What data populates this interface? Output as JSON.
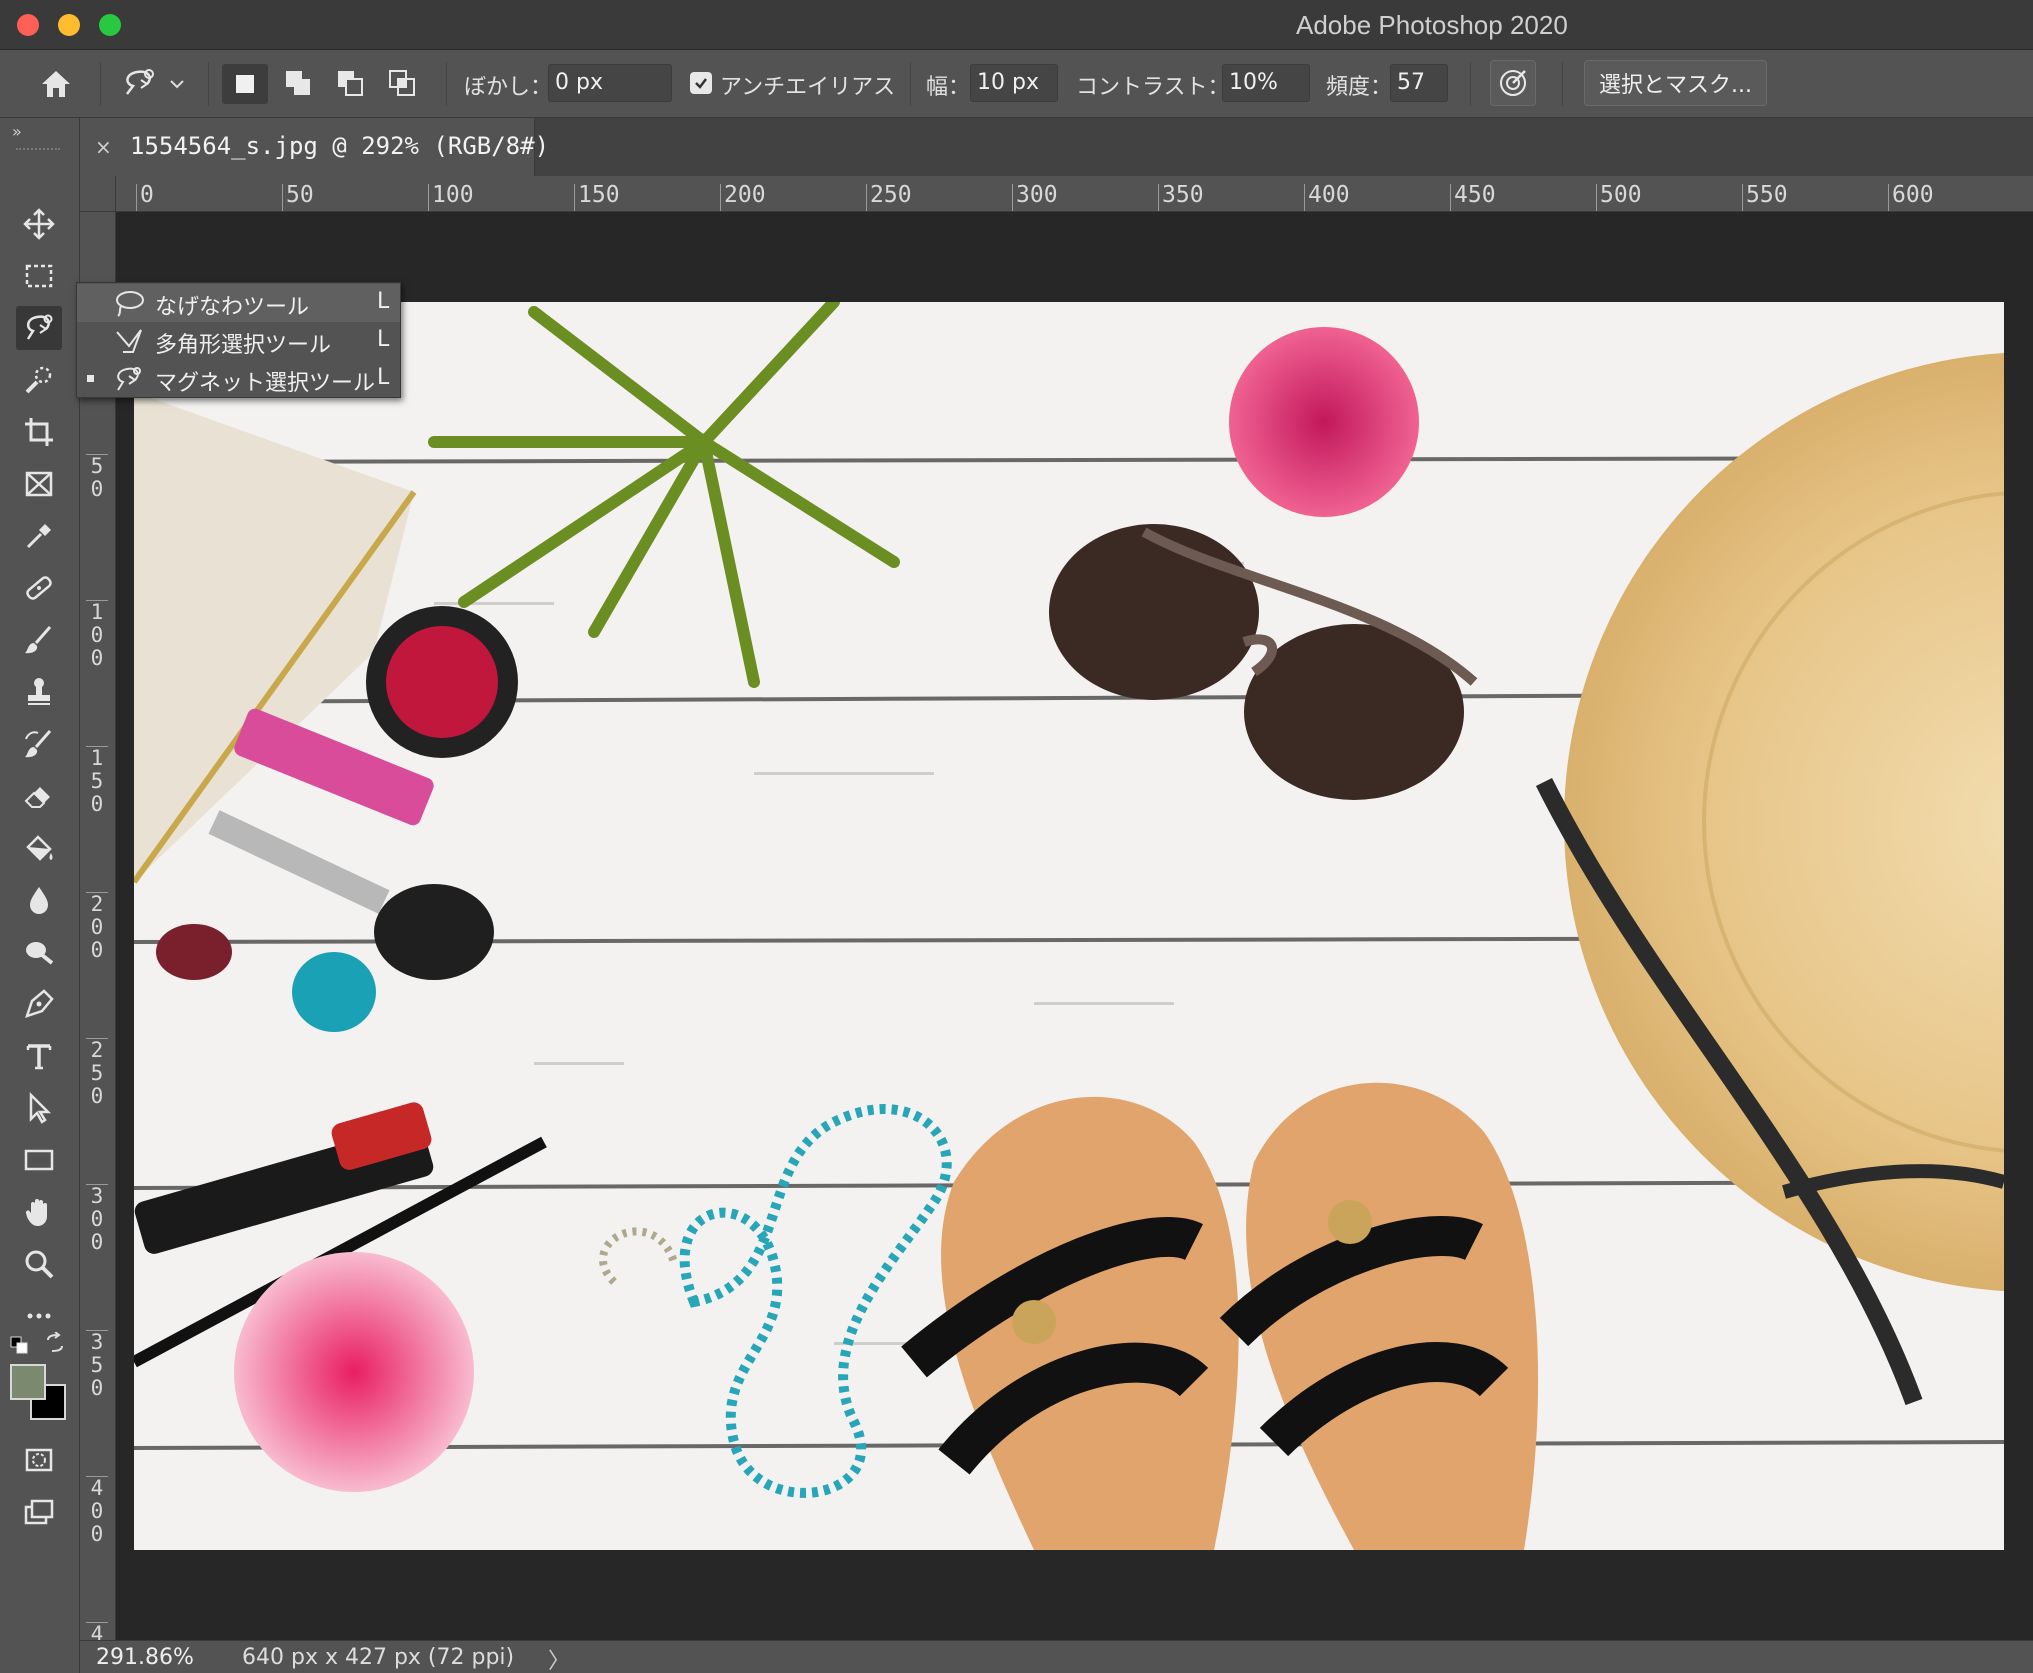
{
  "window": {
    "title": "Adobe Photoshop 2020"
  },
  "options_bar": {
    "feather_label": "ぼかし：",
    "feather_value": "0 px",
    "antialias_label": "アンチエイリアス",
    "antialias_checked": true,
    "width_label": "幅：",
    "width_value": "10 px",
    "contrast_label": "コントラスト：",
    "contrast_value": "10%",
    "frequency_label": "頻度：",
    "frequency_value": "57",
    "select_mask_label": "選択とマスク..."
  },
  "document_tab": {
    "title": "1554564_s.jpg @ 292% (RGB/8#)",
    "close_glyph": "×"
  },
  "rulers": {
    "horizontal": [
      "0",
      "50",
      "100",
      "150",
      "200",
      "250",
      "300",
      "350",
      "400",
      "450",
      "500",
      "550",
      "600"
    ],
    "vertical": [
      "5\n0",
      "1\n0\n0",
      "1\n5\n0",
      "2\n0\n0",
      "2\n5\n0",
      "3\n0\n0",
      "3\n5\n0",
      "4\n0\n0",
      "4"
    ]
  },
  "tool_flyout": {
    "items": [
      {
        "label": "なげなわツール",
        "shortcut": "L",
        "icon": "lasso-icon",
        "selected": false
      },
      {
        "label": "多角形選択ツール",
        "shortcut": "L",
        "icon": "polygonal-lasso-icon",
        "selected": false
      },
      {
        "label": "マグネット選択ツール",
        "shortcut": "L",
        "icon": "magnetic-lasso-icon",
        "selected": true
      }
    ]
  },
  "toolbar": {
    "tools": [
      "move-icon",
      "marquee-icon",
      "magnetic-lasso-icon",
      "quick-select-icon",
      "crop-icon",
      "frame-icon",
      "eyedropper-icon",
      "healing-icon",
      "brush-icon",
      "stamp-icon",
      "history-brush-icon",
      "eraser-icon",
      "paint-bucket-icon",
      "blur-icon",
      "dodge-icon",
      "pen-icon",
      "type-icon",
      "path-select-icon",
      "rectangle-icon",
      "hand-icon",
      "zoom-icon",
      "more-icon"
    ],
    "foreground_color": "#7b8a6e",
    "background_color": "#000000"
  },
  "status_bar": {
    "zoom": "291.86%",
    "doc_info": "640 px x 427 px (72 ppi)",
    "arrow": "〉"
  }
}
